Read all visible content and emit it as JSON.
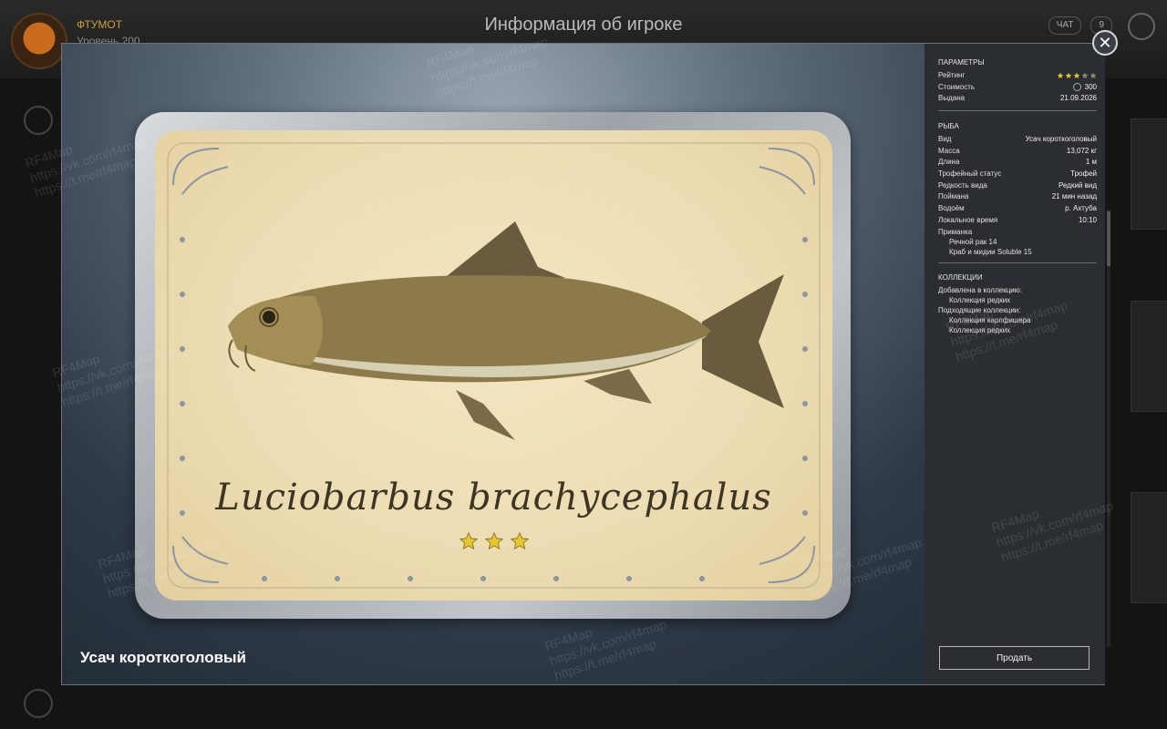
{
  "background": {
    "player_name": "ФТУМОТ",
    "player_level": "Уровень 200",
    "title": "Информация об игроке",
    "pill_1": "ЧАТ",
    "pill_2": "9"
  },
  "fish_card": {
    "latin_name": "Luciobarbus brachycephalus",
    "stars": 3,
    "name": "Усач короткоголовый"
  },
  "parameters": {
    "title": "ПАРАМЕТРЫ",
    "rating_label": "Рейтинг",
    "rating_value": 3,
    "rating_max": 5,
    "cost_label": "Стоимость",
    "cost_value": "300",
    "issued_label": "Выдана",
    "issued_value": "21.09.2026"
  },
  "fish": {
    "title": "РЫБА",
    "rows": [
      {
        "label": "Вид",
        "value": "Усач короткоголовый"
      },
      {
        "label": "Масса",
        "value": "13,072 кг"
      },
      {
        "label": "Длина",
        "value": "1 м"
      },
      {
        "label": "Трофейный статус",
        "value": "Трофей"
      },
      {
        "label": "Редкость вида",
        "value": "Редкий вид"
      },
      {
        "label": "Поймана",
        "value": "21 мин назад"
      },
      {
        "label": "Водоём",
        "value": "р. Ахтуба"
      },
      {
        "label": "Локальное время",
        "value": "10:10"
      }
    ],
    "bait_label": "Приманка",
    "baits": [
      "Речной рак 14",
      "Краб и мидии Soluble 15"
    ]
  },
  "collections": {
    "title": "КОЛЛЕКЦИИ",
    "added_label": "Добавлена в коллекцию:",
    "added": [
      "Коллекция редких"
    ],
    "suitable_label": "Подходящие коллекции:",
    "suitable": [
      "Коллекция карпфишера",
      "Коллекция редких"
    ]
  },
  "sell_button": "Продать",
  "watermark_text": "RF4Map\nhttps://vk.com/rf4map\nhttps://t.me/rf4map",
  "colors": {
    "star_gold": "#e8c533",
    "star_grey": "#8a8a8a",
    "panel_bg": "#2a2d31"
  }
}
